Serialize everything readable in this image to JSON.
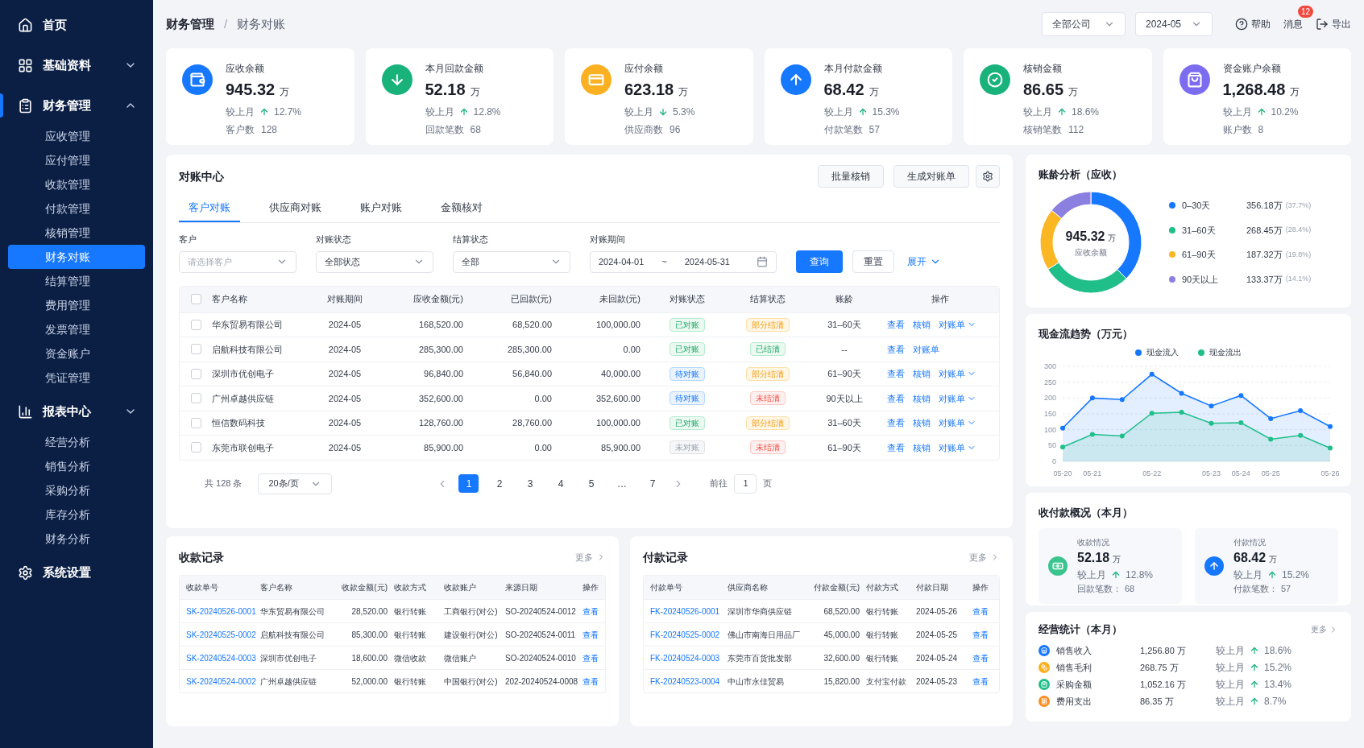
{
  "sidebar": {
    "items": [
      {
        "label": "首页",
        "kind": "link",
        "selected": false
      },
      {
        "label": "基础资料",
        "kind": "group",
        "expanded": false,
        "selected": false
      },
      {
        "label": "财务管理",
        "kind": "group",
        "expanded": true,
        "selected": true,
        "children": [
          {
            "label": "应收管理",
            "selected": false
          },
          {
            "label": "应付管理",
            "selected": false
          },
          {
            "label": "收款管理",
            "selected": false
          },
          {
            "label": "付款管理",
            "selected": false
          },
          {
            "label": "核销管理",
            "selected": false
          },
          {
            "label": "财务对账",
            "selected": true
          },
          {
            "label": "结算管理",
            "selected": false
          },
          {
            "label": "费用管理",
            "selected": false
          },
          {
            "label": "发票管理",
            "selected": false
          },
          {
            "label": "资金账户",
            "selected": false
          },
          {
            "label": "凭证管理",
            "selected": false
          }
        ]
      },
      {
        "label": "报表中心",
        "kind": "group",
        "expanded": false,
        "selected": false,
        "children": [
          {
            "label": "经营分析",
            "selected": false
          },
          {
            "label": "销售分析",
            "selected": false
          },
          {
            "label": "采购分析",
            "selected": false
          },
          {
            "label": "库存分析",
            "selected": false
          },
          {
            "label": "财务分析",
            "selected": false
          }
        ]
      },
      {
        "label": "系统设置",
        "kind": "link",
        "selected": false
      }
    ]
  },
  "header": {
    "breadcrumb": [
      "财务管理",
      "财务对账"
    ],
    "separator": "/",
    "selects": [
      "全部公司",
      "2024-05"
    ],
    "actions": [
      {
        "label": "帮助"
      },
      {
        "label": "消息",
        "badge": "12"
      },
      {
        "label": "导出"
      }
    ]
  },
  "stats": [
    {
      "title": "应收余额",
      "value": "945.32",
      "unit": "万",
      "compare_label": "较上月",
      "rising": true,
      "change": "12.7%",
      "detail_label": "客户数",
      "detail_value": "128",
      "color": "#1677ff"
    },
    {
      "title": "本月回款金额",
      "value": "52.18",
      "unit": "万",
      "compare_label": "较上月",
      "rising": true,
      "change": "12.8%",
      "detail_label": "回款笔数",
      "detail_value": "68",
      "color": "#18b27a"
    },
    {
      "title": "应付余额",
      "value": "623.18",
      "unit": "万",
      "compare_label": "较上月",
      "rising": false,
      "change": "5.3%",
      "detail_label": "供应商数",
      "detail_value": "96",
      "color": "#fbb022"
    },
    {
      "title": "本月付款金额",
      "value": "68.42",
      "unit": "万",
      "compare_label": "较上月",
      "rising": true,
      "change": "15.3%",
      "detail_label": "付款笔数",
      "detail_value": "57",
      "color": "#1677ff"
    },
    {
      "title": "核销金额",
      "value": "86.65",
      "unit": "万",
      "compare_label": "较上月",
      "rising": true,
      "change": "18.6%",
      "detail_label": "核销笔数",
      "detail_value": "112",
      "color": "#18b27a"
    },
    {
      "title": "资金账户余额",
      "value": "1,268.48",
      "unit": "万",
      "compare_label": "较上月",
      "rising": true,
      "change": "10.2%",
      "detail_label": "账户数",
      "detail_value": "8",
      "color": "#7b6cf0"
    }
  ],
  "reconciliation": {
    "title": "对账中心",
    "buttons": [
      "批量核销",
      "生成对账单"
    ],
    "tabs": [
      {
        "label": "客户对账",
        "selected": true
      },
      {
        "label": "供应商对账",
        "selected": false
      },
      {
        "label": "账户对账",
        "selected": false
      },
      {
        "label": "金额核对",
        "selected": false
      }
    ],
    "filters": [
      {
        "label": "客户",
        "placeholder": "请选择客户"
      },
      {
        "label": "对账状态",
        "value": "全部状态"
      },
      {
        "label": "结算状态",
        "value": "全部"
      }
    ],
    "period": {
      "label": "对账期间",
      "start": "2024-04-01",
      "separator": "~",
      "end": "2024-05-31"
    },
    "query_button": "查询",
    "reset_button": "重置",
    "expand_link": "展开",
    "table": {
      "select_all": false,
      "columns": [
        "客户名称",
        "对账期间",
        "应收金额(元)",
        "已回款(元)",
        "未回款(元)",
        "对账状态",
        "结算状态",
        "账龄",
        "操作"
      ],
      "rows": [
        {
          "checked": false,
          "customer": "华东贸易有限公司",
          "period": "2024-05",
          "receivable": "168,520.00",
          "received": "68,520.00",
          "outstanding": "100,000.00",
          "recon": {
            "text": "已对账",
            "kind": "success"
          },
          "settle": {
            "text": "部分结清",
            "kind": "warning"
          },
          "aging": "31–60天",
          "actions": [
            {
              "label": "查看",
              "menu": false
            },
            {
              "label": "核销",
              "menu": false
            },
            {
              "label": "对账单",
              "menu": true
            }
          ]
        },
        {
          "checked": false,
          "customer": "启航科技有限公司",
          "period": "2024-05",
          "receivable": "285,300.00",
          "received": "285,300.00",
          "outstanding": "0.00",
          "recon": {
            "text": "已对账",
            "kind": "success"
          },
          "settle": {
            "text": "已结清",
            "kind": "success"
          },
          "aging": "--",
          "actions": [
            {
              "label": "查看",
              "menu": false
            },
            {
              "label": "对账单",
              "menu": false
            }
          ]
        },
        {
          "checked": false,
          "customer": "深圳市优创电子",
          "period": "2024-05",
          "receivable": "96,840.00",
          "received": "56,840.00",
          "outstanding": "40,000.00",
          "recon": {
            "text": "待对账",
            "kind": "info"
          },
          "settle": {
            "text": "部分结清",
            "kind": "warning"
          },
          "aging": "61–90天",
          "actions": [
            {
              "label": "查看",
              "menu": false
            },
            {
              "label": "核销",
              "menu": false
            },
            {
              "label": "对账单",
              "menu": true
            }
          ]
        },
        {
          "checked": false,
          "customer": "广州卓越供应链",
          "period": "2024-05",
          "receivable": "352,600.00",
          "received": "0.00",
          "outstanding": "352,600.00",
          "recon": {
            "text": "待对账",
            "kind": "info"
          },
          "settle": {
            "text": "未结清",
            "kind": "danger"
          },
          "aging": "90天以上",
          "actions": [
            {
              "label": "查看",
              "menu": false
            },
            {
              "label": "核销",
              "menu": false
            },
            {
              "label": "对账单",
              "menu": true
            }
          ]
        },
        {
          "checked": false,
          "customer": "恒信数码科技",
          "period": "2024-05",
          "receivable": "128,760.00",
          "received": "28,760.00",
          "outstanding": "100,000.00",
          "recon": {
            "text": "已对账",
            "kind": "success"
          },
          "settle": {
            "text": "部分结清",
            "kind": "warning"
          },
          "aging": "31–60天",
          "actions": [
            {
              "label": "查看",
              "menu": false
            },
            {
              "label": "核销",
              "menu": false
            },
            {
              "label": "对账单",
              "menu": true
            }
          ]
        },
        {
          "checked": false,
          "customer": "东莞市联创电子",
          "period": "2024-05",
          "receivable": "85,900.00",
          "received": "0.00",
          "outstanding": "85,900.00",
          "recon": {
            "text": "未对账",
            "kind": "muted"
          },
          "settle": {
            "text": "未结清",
            "kind": "danger"
          },
          "aging": "61–90天",
          "actions": [
            {
              "label": "查看",
              "menu": false
            },
            {
              "label": "核销",
              "menu": false
            },
            {
              "label": "对账单",
              "menu": true
            }
          ]
        }
      ]
    },
    "pagination": {
      "total": "共 128 条",
      "page_size": "20条/页",
      "pages": [
        {
          "label": "1",
          "selected": true
        },
        {
          "label": "2",
          "selected": false
        },
        {
          "label": "3",
          "selected": false
        },
        {
          "label": "4",
          "selected": false
        },
        {
          "label": "5",
          "selected": false
        },
        {
          "label": "…",
          "selected": false
        },
        {
          "label": "7",
          "selected": false
        }
      ],
      "goto_prefix": "前往",
      "goto_value": "1",
      "goto_suffix": "页"
    }
  },
  "receipts": {
    "title": "收款记录",
    "more": "更多",
    "columns": [
      "收款单号",
      "客户名称",
      "收款金额(元)",
      "收款方式",
      "收款账户",
      "来源日期",
      "操作"
    ],
    "rows": [
      [
        "SK-20240526-0001",
        "华东贸易有限公司",
        "28,520.00",
        "银行转账",
        "工商银行(对公)",
        "SO-20240524-0012",
        "查看"
      ],
      [
        "SK-20240525-0002",
        "启航科技有限公司",
        "85,300.00",
        "银行转账",
        "建设银行(对公)",
        "SO-20240524-0011",
        "查看"
      ],
      [
        "SK-20240524-0003",
        "深圳市优创电子",
        "18,600.00",
        "微信收款",
        "微信账户",
        "SO-20240524-0010",
        "查看"
      ],
      [
        "SK-20240524-0002",
        "广州卓越供应链",
        "52,000.00",
        "银行转账",
        "中国银行(对公)",
        "202-20240524-0008",
        "查看"
      ]
    ]
  },
  "payments": {
    "title": "付款记录",
    "more": "更多",
    "columns": [
      "付款单号",
      "供应商名称",
      "付款金额(元)",
      "付款方式",
      "付款日期",
      "操作"
    ],
    "rows": [
      [
        "FK-20240526-0001",
        "深圳市华商供应链",
        "68,520.00",
        "银行转账",
        "2024-05-26",
        "查看"
      ],
      [
        "FK-20240525-0002",
        "佛山市南海日用品厂",
        "45,000.00",
        "银行转账",
        "2024-05-25",
        "查看"
      ],
      [
        "FK-20240524-0003",
        "东莞市百货批发部",
        "32,600.00",
        "银行转账",
        "2024-05-24",
        "查看"
      ],
      [
        "FK-20240523-0004",
        "中山市永佳贸易",
        "15,820.00",
        "支付宝付款",
        "2024-05-23",
        "查看"
      ]
    ]
  },
  "aging": {
    "title": "账龄分析（应收）",
    "center_value": "945.32",
    "center_unit": "万",
    "center_label": "应收余额",
    "legend": [
      {
        "amount": "356.18万",
        "percent": "(37.7%)",
        "color": "#1677ff"
      },
      {
        "amount": "268.45万",
        "percent": "(28.4%)",
        "color": "#20bf8a"
      },
      {
        "amount": "187.32万",
        "percent": "(19.8%)",
        "color": "#fbb624"
      },
      {
        "amount": "133.37万",
        "percent": "(14.1%)",
        "color": "#8b80e0"
      }
    ],
    "chart_data": {
      "type": "donut",
      "categories": [
        "0–30天",
        "31–60天",
        "61–90天",
        "90天以上"
      ],
      "values": [
        37.7,
        28.4,
        19.8,
        14.1
      ]
    }
  },
  "cashflow": {
    "title": "现金流趋势（万元）",
    "chart_data": {
      "type": "area",
      "grid": true,
      "categories": [
        "05-20",
        "05-21",
        null,
        "05-22",
        null,
        "05-23",
        "05-24",
        "05-25",
        null,
        "05-26"
      ],
      "series": [
        {
          "name": "现金流入",
          "color": "#1677ff",
          "marker": true,
          "values": [
            105,
            200,
            195,
            275,
            215,
            175,
            208,
            135,
            160,
            110
          ]
        },
        {
          "name": "现金流出",
          "color": "#20bf8a",
          "marker": true,
          "values": [
            45,
            85,
            80,
            152,
            155,
            120,
            122,
            70,
            82,
            42
          ]
        }
      ],
      "yticks": [
        0,
        50,
        100,
        150,
        200,
        250,
        300
      ],
      "ylim": [
        0,
        300
      ]
    }
  },
  "overview": {
    "title": "收付款概况（本月）",
    "cards": [
      {
        "title": "收款情况",
        "value": "52.18",
        "unit": "万",
        "compare_label": "较上月",
        "rising": true,
        "change": "12.8%",
        "detail_label": "回款笔数：",
        "detail_value": "68",
        "color": "#3cc48f"
      },
      {
        "title": "付款情况",
        "value": "68.42",
        "unit": "万",
        "compare_label": "较上月",
        "rising": true,
        "change": "15.2%",
        "detail_label": "付款笔数：",
        "detail_value": "57",
        "color": "#1677ff"
      }
    ]
  },
  "operations": {
    "title": "经营统计（本月）",
    "more": "更多",
    "rows": [
      {
        "label": "销售收入",
        "value": "1,256.80 万",
        "compare_label": "较上月",
        "rising": true,
        "change": "18.6%",
        "color": "#1677ff"
      },
      {
        "label": "销售毛利",
        "value": "268.75 万",
        "compare_label": "较上月",
        "rising": true,
        "change": "15.2%",
        "color": "#fbb022"
      },
      {
        "label": "采购金额",
        "value": "1,052.16 万",
        "compare_label": "较上月",
        "rising": true,
        "change": "13.4%",
        "color": "#20bf8a"
      },
      {
        "label": "费用支出",
        "value": "86.35 万",
        "compare_label": "较上月",
        "rising": true,
        "change": "8.7%",
        "color": "#fb8c1e"
      }
    ]
  }
}
